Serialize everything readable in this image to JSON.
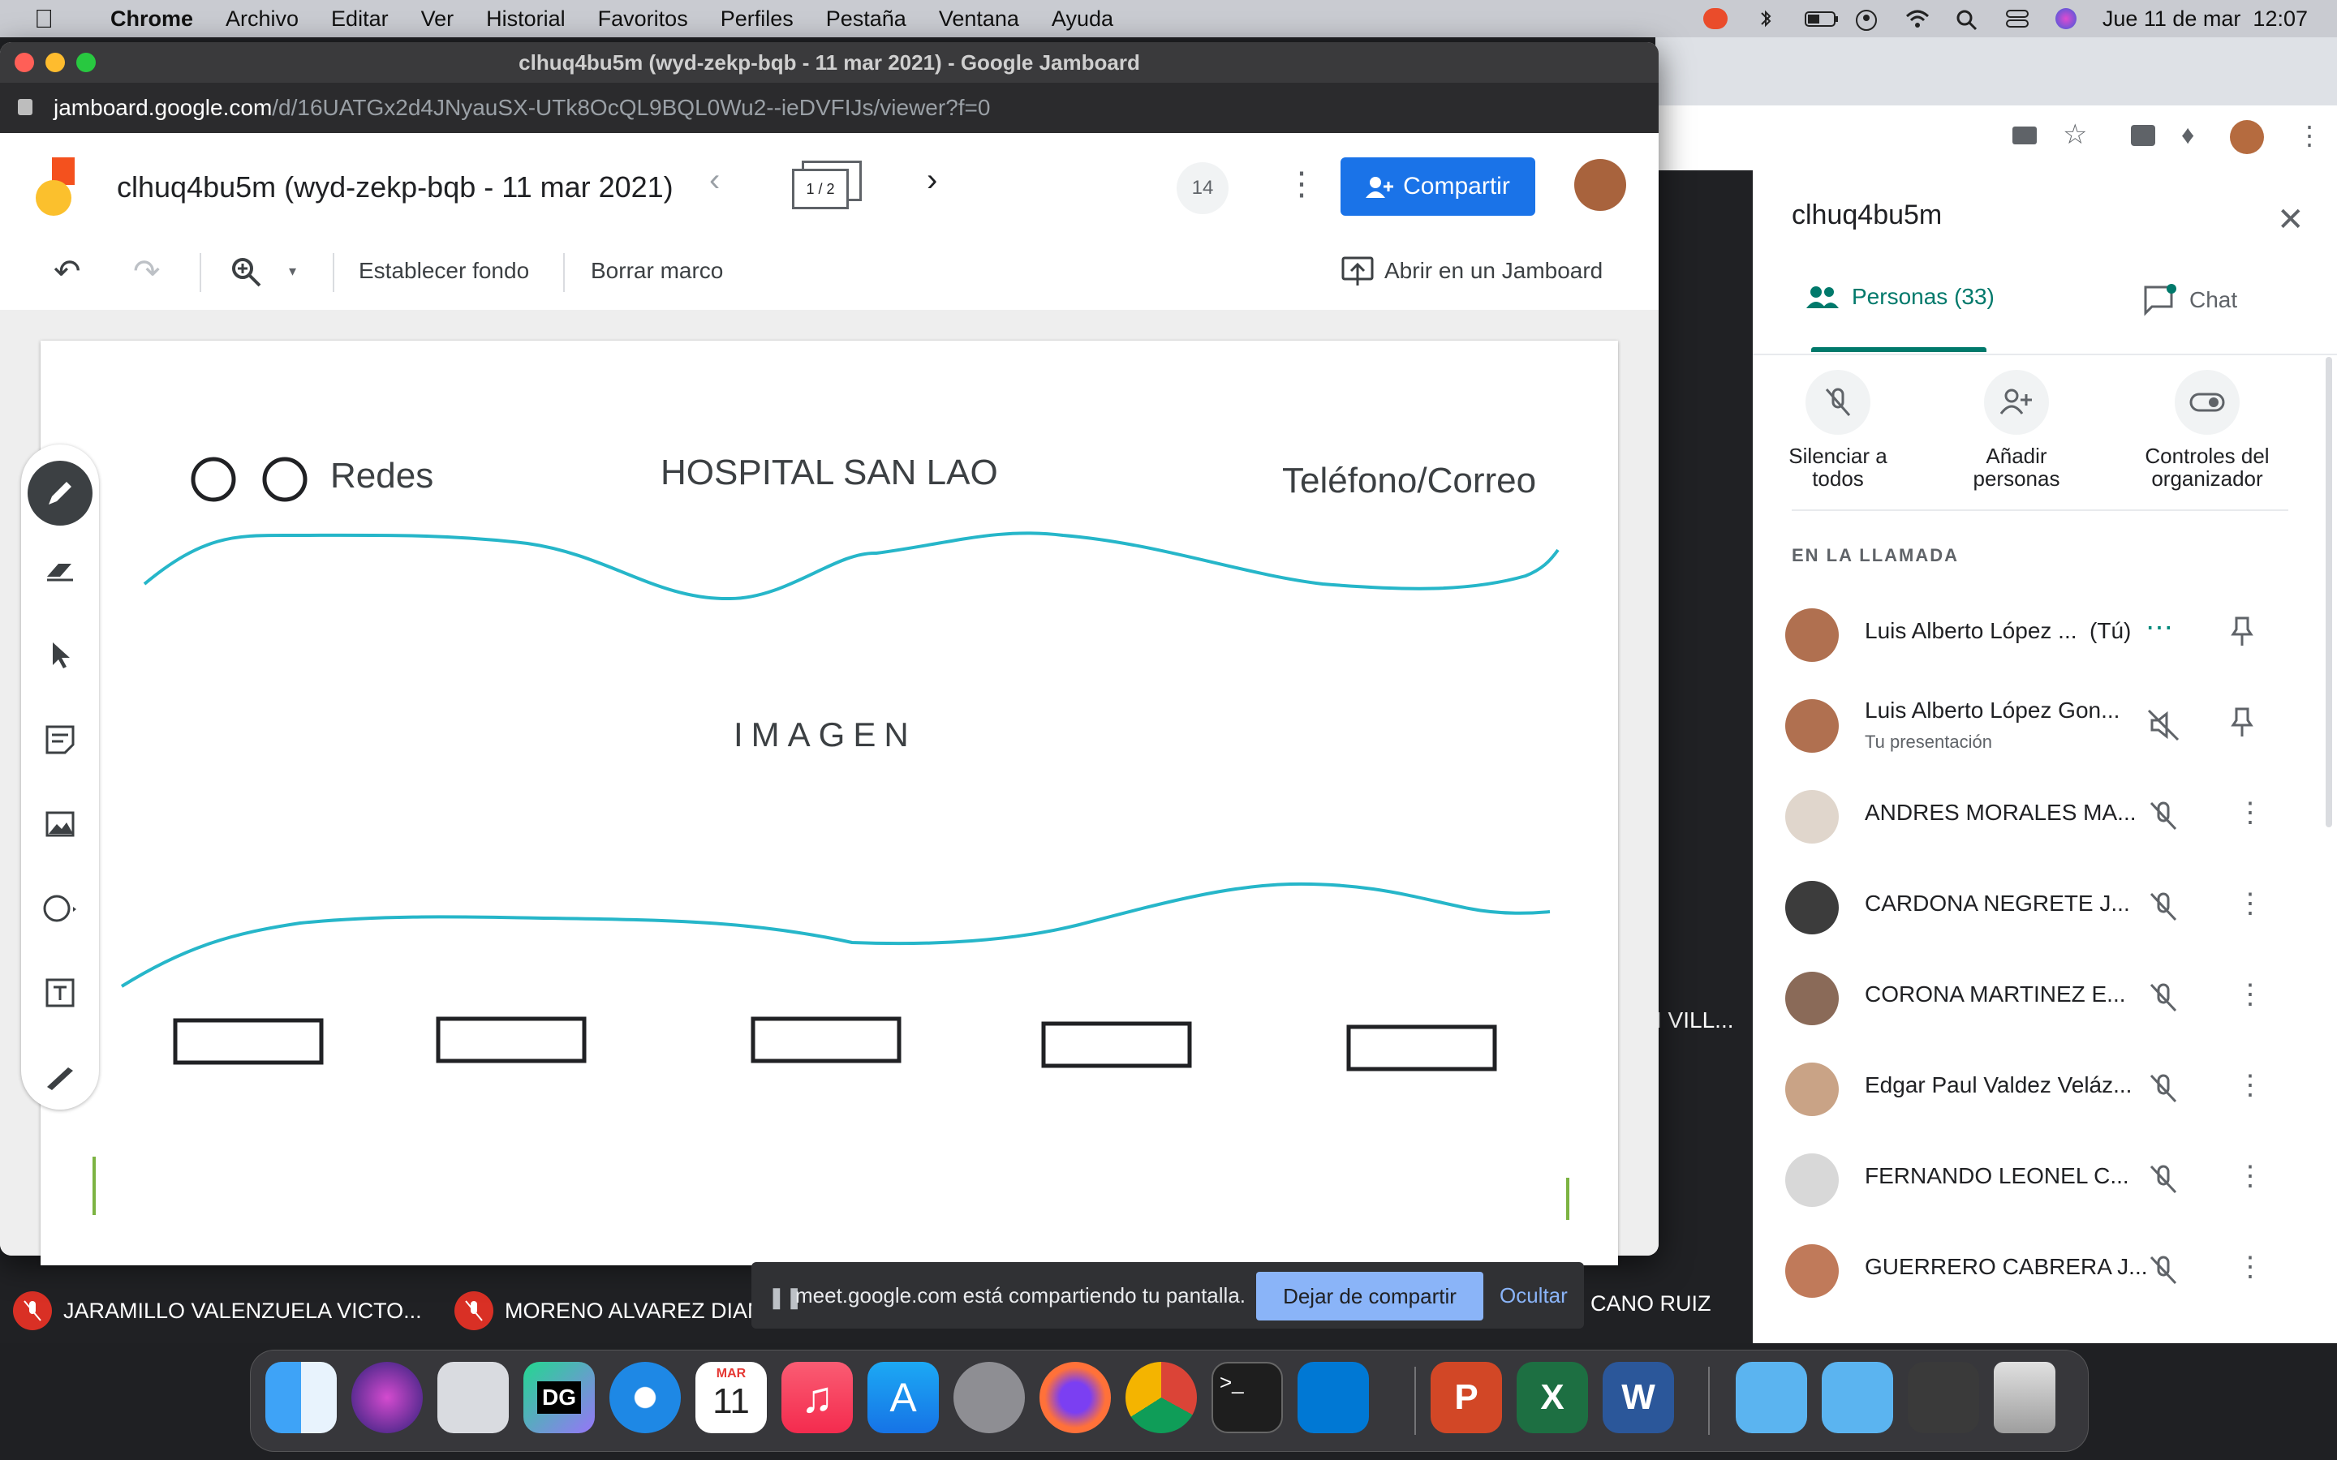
{
  "menubar": {
    "app": "Chrome",
    "items": [
      "Archivo",
      "Editar",
      "Ver",
      "Historial",
      "Favoritos",
      "Perfiles",
      "Pestaña",
      "Ventana",
      "Ayuda"
    ],
    "clock": "Jue 11 de mar  12:07"
  },
  "window": {
    "title": "clhuq4bu5m (wyd-zekp-bqb - 11 mar 2021) - Google Jamboard",
    "url_host": "jamboard.google.com",
    "url_path": "/d/16UATGx2d4JNyauSX-UTk8OcQL9BQL0Wu2--ieDVFIJs/viewer?f=0"
  },
  "jamboard": {
    "doc_title": "clhuq4bu5m (wyd-zekp-bqb - 11 mar 2021)",
    "frame_indicator": "1 / 2",
    "viewer_count": "14",
    "share_label": "Compartir",
    "set_background": "Establecer fondo",
    "clear_frame": "Borrar marco",
    "open_in_jamboard": "Abrir en un Jamboard"
  },
  "board": {
    "redes": "Redes",
    "hospital": "HOSPITAL SAN LAO",
    "contact": "Teléfono/Correo",
    "image": "IMAGEN"
  },
  "meet_panel": {
    "title": "clhuq4bu5m",
    "tab_people": "Personas (33)",
    "tab_chat": "Chat",
    "actions": [
      {
        "label": "Silenciar a todos"
      },
      {
        "label": "Añadir personas"
      },
      {
        "label": "Controles del organizador"
      }
    ],
    "section_label": "EN LA LLAMADA",
    "participants": [
      {
        "name": "Luis Alberto López ...  (Tú)",
        "sub": ""
      },
      {
        "name": "Luis Alberto López Gon...",
        "sub": "Tu presentación"
      },
      {
        "name": "ANDRES MORALES MA...",
        "sub": ""
      },
      {
        "name": "CARDONA NEGRETE J...",
        "sub": ""
      },
      {
        "name": "CORONA MARTINEZ E...",
        "sub": ""
      },
      {
        "name": "Edgar Paul Valdez Veláz...",
        "sub": ""
      },
      {
        "name": "FERNANDO LEONEL C...",
        "sub": ""
      },
      {
        "name": "GUERRERO CABRERA J...",
        "sub": ""
      }
    ]
  },
  "meet_tiles": {
    "tile1": "JARAMILLO VALENZUELA VICTO...",
    "tile2": "MORENO ALVAREZ DIAN",
    "tile3": "CANO RUIZ",
    "side_label": "I VILL..."
  },
  "sharebar": {
    "message": "meet.google.com está compartiendo tu pantalla.",
    "stop": "Dejar de compartir",
    "hide": "Ocultar"
  },
  "dock": {
    "calendar_month": "MAR",
    "calendar_day": "11",
    "dg_label": "DG"
  }
}
